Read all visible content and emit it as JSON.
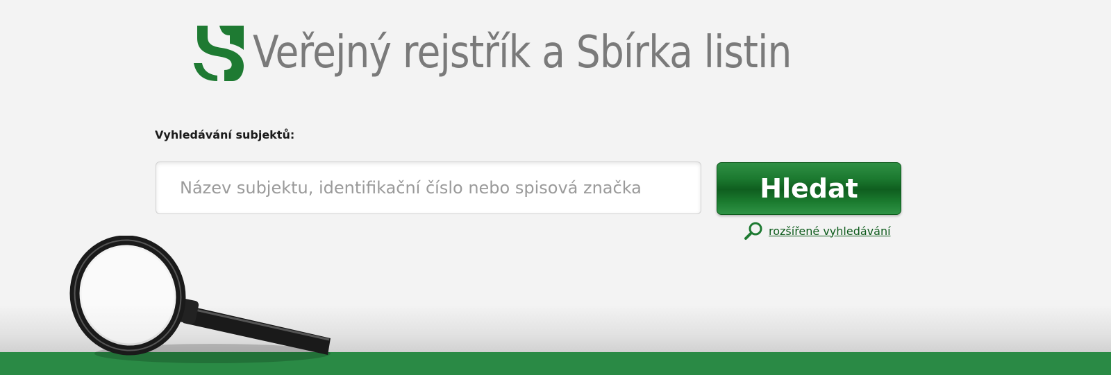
{
  "header": {
    "title": "Veřejný rejstřík a Sbírka listin",
    "logo_icon": "justice-s-logo-icon",
    "logo_color": "#1e7a32",
    "title_color": "#7a7a7a"
  },
  "search": {
    "label": "Vyhledávání subjektů:",
    "placeholder": "Název subjektu, identifikační číslo nebo spisová značka",
    "value": "",
    "button_label": "Hledat",
    "button_color": "#1c7a30",
    "advanced_link_label": "rozšířené vyhledávání",
    "advanced_link_icon": "magnifier-icon",
    "link_color": "#0c5a1a"
  },
  "footer": {
    "bar_color": "#2a8a45",
    "decoration_icon": "magnifying-glass-decoration"
  }
}
